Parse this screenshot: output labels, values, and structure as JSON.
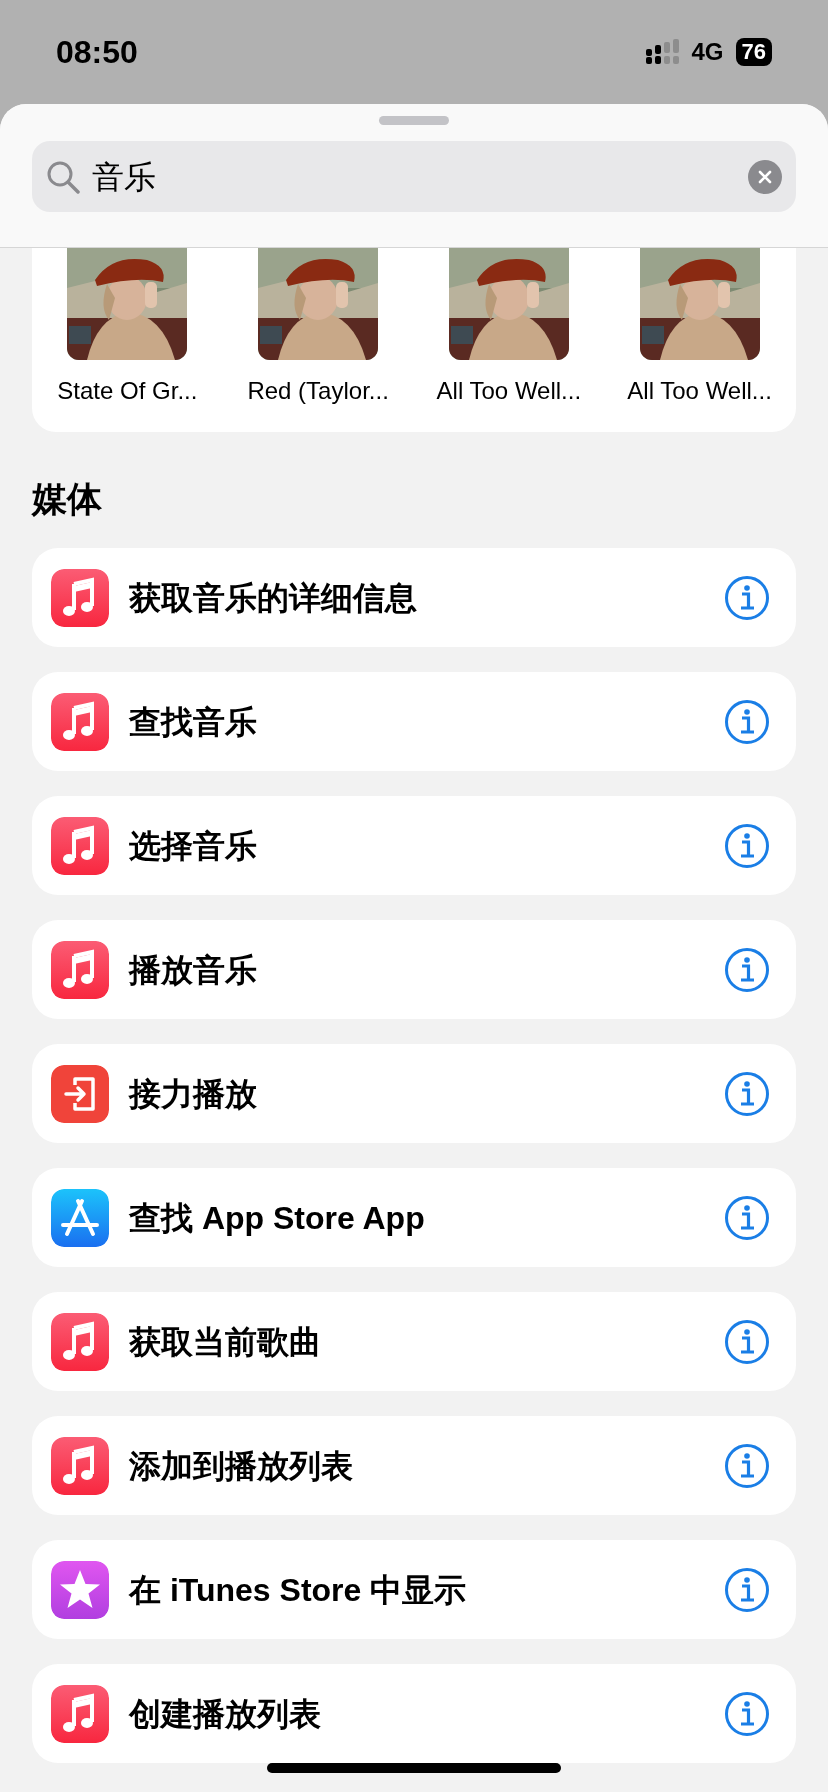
{
  "status_bar": {
    "time": "08:50",
    "network": "4G",
    "battery": "76"
  },
  "search": {
    "value": "音乐"
  },
  "albums": [
    {
      "title": "State Of Gr...",
      "kind": "picture"
    },
    {
      "title": "Red (Taylor...",
      "kind": "picture"
    },
    {
      "title": "All Too Well...",
      "kind": "picture"
    },
    {
      "title": "All Too Well...",
      "kind": "picture"
    }
  ],
  "section": {
    "title": "媒体"
  },
  "actions": [
    {
      "label": "获取音乐的详细信息",
      "kind": "music"
    },
    {
      "label": "查找音乐",
      "kind": "music"
    },
    {
      "label": "选择音乐",
      "kind": "music"
    },
    {
      "label": "播放音乐",
      "kind": "music"
    },
    {
      "label": "接力播放",
      "kind": "handoff"
    },
    {
      "label": "查找 App Store App",
      "kind": "appstore"
    },
    {
      "label": "获取当前歌曲",
      "kind": "music"
    },
    {
      "label": "添加到播放列表",
      "kind": "music"
    },
    {
      "label": "在 iTunes Store 中显示",
      "kind": "itunes"
    },
    {
      "label": "创建播放列表",
      "kind": "music"
    }
  ]
}
